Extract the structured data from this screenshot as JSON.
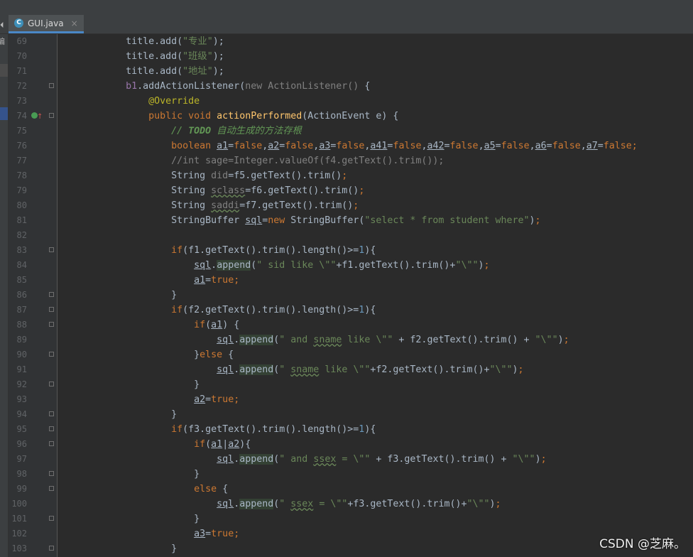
{
  "tab": {
    "icon": "C",
    "label": "GUI.java",
    "close": "×"
  },
  "sidebar": {
    "glyph": "编"
  },
  "code_lines": [
    {
      "n": "69",
      "fold": false,
      "html": "            title.add(<span class=\"s\">\"专业\"</span>);"
    },
    {
      "n": "70",
      "fold": false,
      "html": "            title.add(<span class=\"s\">\"班级\"</span>);"
    },
    {
      "n": "71",
      "fold": false,
      "html": "            title.add(<span class=\"s\">\"地址\"</span>);"
    },
    {
      "n": "72",
      "fold": true,
      "html": "            <span style=\"color:#9876aa\">b1</span>.addActionListener(<span class=\"c\">new ActionListener() </span>{"
    },
    {
      "n": "73",
      "fold": false,
      "html": "                <span class=\"a\">@Override</span>"
    },
    {
      "n": "74",
      "fold": true,
      "marker": true,
      "html": "                <span class=\"k\">public void </span><span class=\"f\">actionPerformed</span>(ActionEvent e) {"
    },
    {
      "n": "75",
      "fold": false,
      "html": "                    <span class=\"cm\">// <b>TODO</b> 自动生成的方法存根</span>"
    },
    {
      "n": "76",
      "fold": false,
      "html": "                    <span class=\"k\">boolean </span><span class=\"v\">a1</span>=<span class=\"k\">false</span>,<span class=\"v\">a2</span>=<span class=\"k\">false</span>,<span class=\"v\">a3</span>=<span class=\"k\">false</span>,<span class=\"v\">a41</span>=<span class=\"k\">false</span>,<span class=\"v\">a42</span>=<span class=\"k\">false</span>,<span class=\"v\">a5</span>=<span class=\"k\">false</span>,<span class=\"v\">a6</span>=<span class=\"k\">false</span>,<span class=\"v\">a7</span>=<span class=\"k\">false</span><span class=\"k\">;</span>"
    },
    {
      "n": "77",
      "fold": false,
      "html": "                    <span class=\"c\">//int sage=Integer.valueOf(f4.getText().trim());</span>"
    },
    {
      "n": "78",
      "fold": false,
      "html": "                    String <span class=\"c\">did</span>=f5.getText().trim()<span class=\"k\">;</span>"
    },
    {
      "n": "79",
      "fold": false,
      "html": "                    String <span class=\"c sq\">sclass</span>=f6.getText().trim()<span class=\"k\">;</span>"
    },
    {
      "n": "80",
      "fold": false,
      "html": "                    String <span class=\"c sq\">saddi</span>=f7.getText().trim()<span class=\"k\">;</span>"
    },
    {
      "n": "81",
      "fold": false,
      "html": "                    StringBuffer <span class=\"v\">sql</span>=<span class=\"k\">new </span>StringBuffer(<span class=\"s\">\"select * from student where\"</span>)<span class=\"k\">;</span>"
    },
    {
      "n": "82",
      "fold": false,
      "html": ""
    },
    {
      "n": "83",
      "fold": true,
      "html": "                    <span class=\"k\">if</span>(f1.getText().trim().length()>=<span style=\"color:#6897bb\">1</span>){"
    },
    {
      "n": "84",
      "fold": false,
      "html": "                        <span class=\"v\">sql</span>.<span class=\"hl\">append</span>(<span class=\"s\">\" sid like \\\"\"</span>+f1.getText().trim()+<span class=\"s\">\"\\\"\"</span>)<span class=\"k\">;</span>"
    },
    {
      "n": "85",
      "fold": false,
      "html": "                        <span class=\"v\">a1</span>=<span class=\"k\">true;</span>"
    },
    {
      "n": "86",
      "fold": true,
      "html": "                    }"
    },
    {
      "n": "87",
      "fold": true,
      "html": "                    <span class=\"k\">if</span>(f2.getText().trim().length()>=<span style=\"color:#6897bb\">1</span>){"
    },
    {
      "n": "88",
      "fold": true,
      "html": "                        <span class=\"k\">if</span>(<span class=\"v\">a1</span>) {"
    },
    {
      "n": "89",
      "fold": false,
      "html": "                            <span class=\"v\">sql</span>.<span class=\"hl\">append</span>(<span class=\"s\">\" and <span class=\"sq\" style=\"text-decoration:underline wavy #6a8759\">sname</span> like \\\"\"</span> + f2.getText().trim() + <span class=\"s\">\"\\\"\"</span>)<span class=\"k\">;</span>"
    },
    {
      "n": "90",
      "fold": true,
      "html": "                        }<span class=\"k\">else </span>{"
    },
    {
      "n": "91",
      "fold": false,
      "html": "                            <span class=\"v\">sql</span>.<span class=\"hl\">append</span>(<span class=\"s\">\" <span style=\"text-decoration:underline wavy #6a8759\">sname</span> like \\\"\"</span>+f2.getText().trim()+<span class=\"s\">\"\\\"\"</span>)<span class=\"k\">;</span>"
    },
    {
      "n": "92",
      "fold": true,
      "html": "                        }"
    },
    {
      "n": "93",
      "fold": false,
      "html": "                        <span class=\"v\">a2</span>=<span class=\"k\">true;</span>"
    },
    {
      "n": "94",
      "fold": true,
      "html": "                    }"
    },
    {
      "n": "95",
      "fold": true,
      "html": "                    <span class=\"k\">if</span>(f3.getText().trim().length()>=<span style=\"color:#6897bb\">1</span>){"
    },
    {
      "n": "96",
      "fold": true,
      "html": "                        <span class=\"k\">if</span>(<span class=\"v\">a1</span>|<span class=\"v\">a2</span>){"
    },
    {
      "n": "97",
      "fold": false,
      "html": "                            <span class=\"v\">sql</span>.<span class=\"hl\">append</span>(<span class=\"s\">\" and <span style=\"text-decoration:underline wavy #6a8759\">ssex</span> = \\\"\"</span> + f3.getText().trim() + <span class=\"s\">\"\\\"\"</span>)<span class=\"k\">;</span>"
    },
    {
      "n": "98",
      "fold": true,
      "html": "                        }"
    },
    {
      "n": "99",
      "fold": true,
      "html": "                        <span class=\"k\">else </span>{"
    },
    {
      "n": "100",
      "fold": false,
      "html": "                            <span class=\"v\">sql</span>.<span class=\"hl\">append</span>(<span class=\"s\">\" <span style=\"text-decoration:underline wavy #6a8759\">ssex</span> = \\\"\"</span>+f3.getText().trim()+<span class=\"s\">\"\\\"\"</span>)<span class=\"k\">;</span>"
    },
    {
      "n": "101",
      "fold": true,
      "html": "                        }"
    },
    {
      "n": "102",
      "fold": false,
      "html": "                        <span class=\"v\">a3</span>=<span class=\"k\">true;</span>"
    },
    {
      "n": "103",
      "fold": true,
      "html": "                    }"
    }
  ],
  "watermark": "CSDN @芝麻。"
}
